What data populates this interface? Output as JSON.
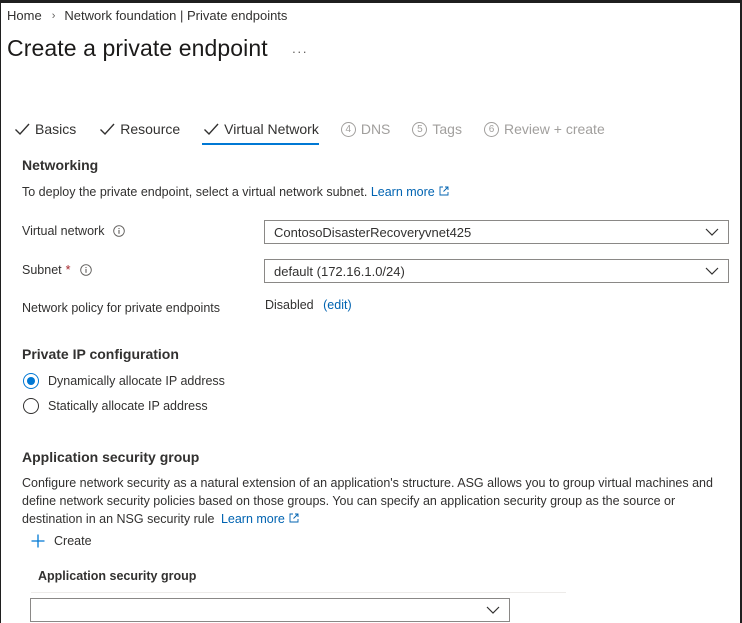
{
  "breadcrumb": {
    "home": "Home",
    "separator": "›",
    "current": "Network foundation | Private endpoints"
  },
  "title": "Create a private endpoint",
  "more_label": "···",
  "tabs": [
    {
      "label": "Basics",
      "state": "done"
    },
    {
      "label": "Resource",
      "state": "done"
    },
    {
      "label": "Virtual Network",
      "state": "active"
    },
    {
      "label": "DNS",
      "state": "disabled",
      "step": "4"
    },
    {
      "label": "Tags",
      "state": "disabled",
      "step": "5"
    },
    {
      "label": "Review + create",
      "state": "disabled",
      "step": "6"
    }
  ],
  "networking": {
    "heading": "Networking",
    "description": "To deploy the private endpoint, select a virtual network subnet.",
    "learn_more": "Learn more",
    "virtual_network_label": "Virtual network",
    "virtual_network_value": "ContosoDisasterRecoveryvnet425",
    "subnet_label": "Subnet",
    "required_mark": "*",
    "subnet_value": "default (172.16.1.0/24)",
    "policy_label": "Network policy for private endpoints",
    "policy_value": "Disabled",
    "policy_edit": "(edit)"
  },
  "private_ip": {
    "heading": "Private IP configuration",
    "options": [
      {
        "label": "Dynamically allocate IP address",
        "selected": true
      },
      {
        "label": "Statically allocate IP address",
        "selected": false
      }
    ]
  },
  "asg": {
    "heading": "Application security group",
    "description": "Configure network security as a natural extension of an application's structure. ASG allows you to group virtual machines and define network security policies based on those groups. You can specify an application security group as the source or destination in an NSG security rule",
    "learn_more": "Learn more",
    "create_label": "Create",
    "column_header": "Application security group",
    "select_value": ""
  },
  "colors": {
    "accent": "#0078d4",
    "link": "#0063b1",
    "required": "#a4262c",
    "disabled": "#a19f9d"
  }
}
